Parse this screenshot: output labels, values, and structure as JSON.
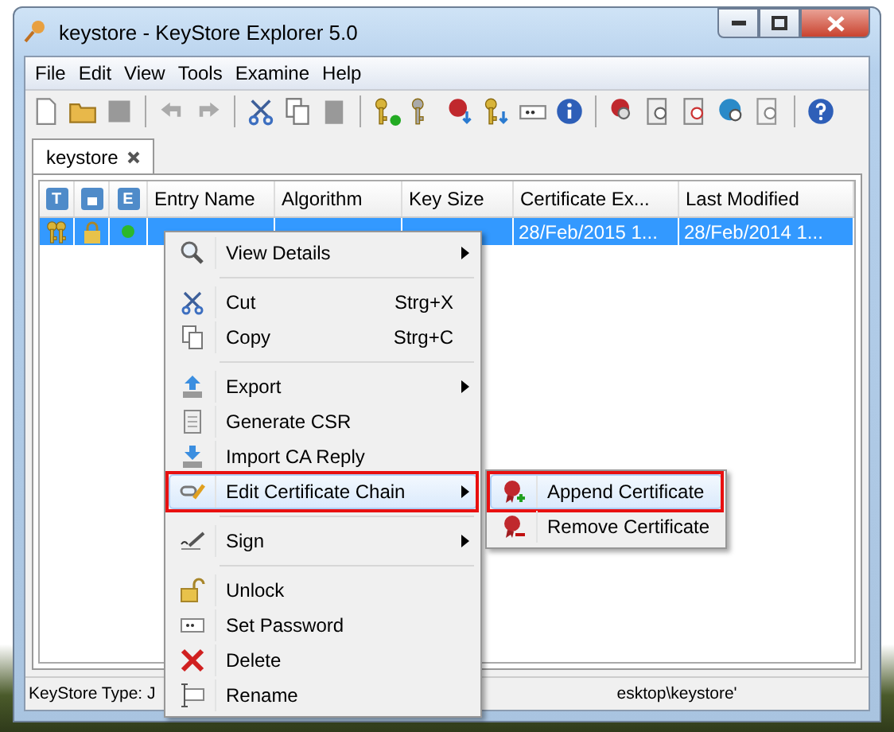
{
  "window": {
    "title": "keystore - KeyStore Explorer 5.0"
  },
  "menu_bar": [
    "File",
    "Edit",
    "View",
    "Tools",
    "Examine",
    "Help"
  ],
  "document_tab": {
    "label": "keystore",
    "selected": true
  },
  "table": {
    "columns": [
      {
        "kind": "icon",
        "label": "T"
      },
      {
        "kind": "icon"
      },
      {
        "kind": "icon",
        "label": "E"
      },
      {
        "kind": "text",
        "label": "Entry Name"
      },
      {
        "kind": "text",
        "label": "Algorithm"
      },
      {
        "kind": "text",
        "label": "Key Size"
      },
      {
        "kind": "text",
        "label": "Certificate Ex..."
      },
      {
        "kind": "text",
        "label": "Last Modified"
      }
    ],
    "rows": [
      {
        "selected": true,
        "certificate_expiry": "28/Feb/2015 1...",
        "last_modified": "28/Feb/2014 1..."
      }
    ]
  },
  "status_bar": {
    "left": "KeyStore Type: J",
    "right": "esktop\\keystore'"
  },
  "context_menu": [
    {
      "kind": "item",
      "label": "View Details",
      "submenu": true,
      "selected": false,
      "marked": false
    },
    {
      "kind": "separator"
    },
    {
      "kind": "item",
      "label": "Cut",
      "shortcut": "Strg+X",
      "submenu": false,
      "selected": false,
      "marked": false
    },
    {
      "kind": "item",
      "label": "Copy",
      "shortcut": "Strg+C",
      "submenu": false,
      "selected": false,
      "marked": false
    },
    {
      "kind": "separator"
    },
    {
      "kind": "item",
      "label": "Export",
      "submenu": true,
      "selected": false,
      "marked": false
    },
    {
      "kind": "item",
      "label": "Generate CSR",
      "submenu": false,
      "selected": false,
      "marked": false
    },
    {
      "kind": "item",
      "label": "Import CA Reply",
      "submenu": false,
      "selected": false,
      "marked": false
    },
    {
      "kind": "item",
      "label": "Edit Certificate Chain",
      "submenu": true,
      "selected": true,
      "marked": true
    },
    {
      "kind": "separator"
    },
    {
      "kind": "item",
      "label": "Sign",
      "submenu": true,
      "selected": false,
      "marked": false
    },
    {
      "kind": "separator"
    },
    {
      "kind": "item",
      "label": "Unlock",
      "submenu": false,
      "selected": false,
      "marked": false
    },
    {
      "kind": "item",
      "label": "Set Password",
      "submenu": false,
      "selected": false,
      "marked": false
    },
    {
      "kind": "item",
      "label": "Delete",
      "submenu": false,
      "selected": false,
      "marked": false
    },
    {
      "kind": "item",
      "label": "Rename",
      "submenu": false,
      "selected": false,
      "marked": false
    }
  ],
  "submenu": [
    {
      "label": "Append Certificate",
      "selected": true,
      "marked": true
    },
    {
      "label": "Remove Certificate",
      "selected": false,
      "marked": false
    }
  ]
}
